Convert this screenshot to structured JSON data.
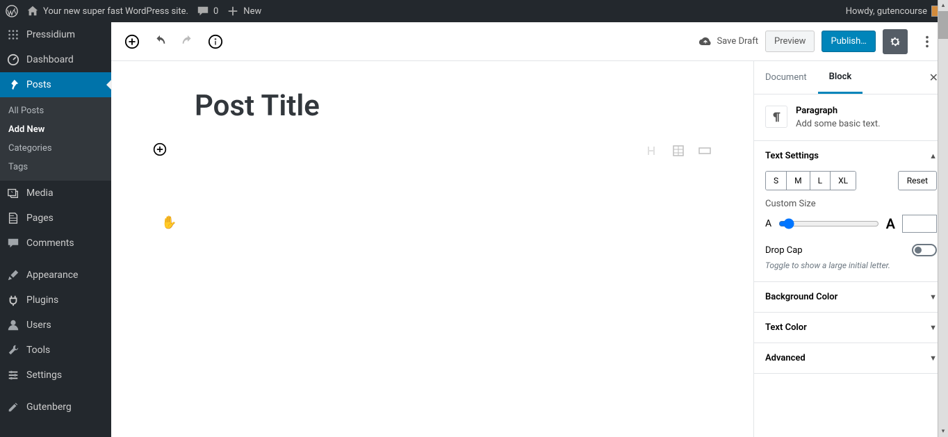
{
  "adminBar": {
    "siteName": "Your new super fast WordPress site.",
    "commentCount": "0",
    "newLabel": "New",
    "greeting": "Howdy, gutencourse"
  },
  "sidebar": {
    "homeLabel": "Pressidium",
    "items": [
      {
        "label": "Dashboard",
        "icon": "dashboard"
      },
      {
        "label": "Posts",
        "icon": "pin",
        "active": true
      },
      {
        "label": "Media",
        "icon": "media"
      },
      {
        "label": "Pages",
        "icon": "pages"
      },
      {
        "label": "Comments",
        "icon": "comments"
      },
      {
        "label": "Appearance",
        "icon": "brush"
      },
      {
        "label": "Plugins",
        "icon": "plug"
      },
      {
        "label": "Users",
        "icon": "user"
      },
      {
        "label": "Tools",
        "icon": "wrench"
      },
      {
        "label": "Settings",
        "icon": "settings"
      },
      {
        "label": "Gutenberg",
        "icon": "edit"
      }
    ],
    "postsSubmenu": [
      {
        "label": "All Posts"
      },
      {
        "label": "Add New",
        "active": true
      },
      {
        "label": "Categories"
      },
      {
        "label": "Tags"
      }
    ]
  },
  "editor": {
    "header": {
      "saveDraft": "Save Draft",
      "preview": "Preview",
      "publish": "Publish…"
    },
    "title": "Post Title"
  },
  "settings": {
    "tabs": {
      "document": "Document",
      "block": "Block"
    },
    "block": {
      "name": "Paragraph",
      "description": "Add some basic text."
    },
    "textSettings": {
      "title": "Text Settings",
      "sizes": [
        "S",
        "M",
        "L",
        "XL"
      ],
      "reset": "Reset",
      "customSizeLabel": "Custom Size",
      "dropCapLabel": "Drop Cap",
      "dropCapHelp": "Toggle to show a large initial letter."
    },
    "backgroundColor": {
      "title": "Background Color"
    },
    "textColor": {
      "title": "Text Color"
    },
    "advanced": {
      "title": "Advanced"
    }
  }
}
